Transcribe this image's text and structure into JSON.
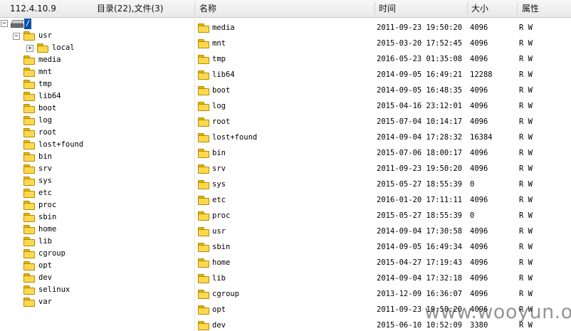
{
  "header": {
    "host": "112.4.10.9",
    "summary": "目录(22),文件(3)",
    "col_name": "名称",
    "col_time": "时间",
    "col_size": "大小",
    "col_attr": "属性"
  },
  "tree": {
    "root_label": "/",
    "items": [
      {
        "label": "usr",
        "expanded": true
      },
      {
        "label": "local",
        "expanded": false
      },
      {
        "label": "media"
      },
      {
        "label": "mnt"
      },
      {
        "label": "tmp"
      },
      {
        "label": "lib64"
      },
      {
        "label": "boot"
      },
      {
        "label": "log"
      },
      {
        "label": "root"
      },
      {
        "label": "lost+found"
      },
      {
        "label": "bin"
      },
      {
        "label": "srv"
      },
      {
        "label": "sys"
      },
      {
        "label": "etc"
      },
      {
        "label": "proc"
      },
      {
        "label": "sbin"
      },
      {
        "label": "home"
      },
      {
        "label": "lib"
      },
      {
        "label": "cgroup"
      },
      {
        "label": "opt"
      },
      {
        "label": "dev"
      },
      {
        "label": "selinux"
      },
      {
        "label": "var"
      }
    ]
  },
  "files": [
    {
      "name": "media",
      "time": "2011-09-23 19:50:20",
      "size": "4096",
      "attr": "R W"
    },
    {
      "name": "mnt",
      "time": "2015-03-20 17:52:45",
      "size": "4096",
      "attr": "R W"
    },
    {
      "name": "tmp",
      "time": "2016-05-23 01:35:08",
      "size": "4096",
      "attr": "R W"
    },
    {
      "name": "lib64",
      "time": "2014-09-05 16:49:21",
      "size": "12288",
      "attr": "R W"
    },
    {
      "name": "boot",
      "time": "2014-09-05 16:48:35",
      "size": "4096",
      "attr": "R W"
    },
    {
      "name": "log",
      "time": "2015-04-16 23:12:01",
      "size": "4096",
      "attr": "R W"
    },
    {
      "name": "root",
      "time": "2015-07-04 10:14:17",
      "size": "4096",
      "attr": "R W"
    },
    {
      "name": "lost+found",
      "time": "2014-09-04 17:28:32",
      "size": "16384",
      "attr": "R W"
    },
    {
      "name": "bin",
      "time": "2015-07-06 18:00:17",
      "size": "4096",
      "attr": "R W"
    },
    {
      "name": "srv",
      "time": "2011-09-23 19:50:20",
      "size": "4096",
      "attr": "R W"
    },
    {
      "name": "sys",
      "time": "2015-05-27 18:55:39",
      "size": "0",
      "attr": "R W"
    },
    {
      "name": "etc",
      "time": "2016-01-20 17:11:11",
      "size": "4096",
      "attr": "R W"
    },
    {
      "name": "proc",
      "time": "2015-05-27 18:55:39",
      "size": "0",
      "attr": "R W"
    },
    {
      "name": "usr",
      "time": "2014-09-04 17:30:58",
      "size": "4096",
      "attr": "R W"
    },
    {
      "name": "sbin",
      "time": "2014-09-05 16:49:34",
      "size": "4096",
      "attr": "R W"
    },
    {
      "name": "home",
      "time": "2015-04-27 17:19:43",
      "size": "4096",
      "attr": "R W"
    },
    {
      "name": "lib",
      "time": "2014-09-04 17:32:18",
      "size": "4096",
      "attr": "R W"
    },
    {
      "name": "cgroup",
      "time": "2013-12-09 16:36:07",
      "size": "4096",
      "attr": "R W"
    },
    {
      "name": "opt",
      "time": "2011-09-23 19:50:20",
      "size": "4096",
      "attr": "R W"
    },
    {
      "name": "dev",
      "time": "2015-06-10 10:52:09",
      "size": "3380",
      "attr": "R W"
    }
  ],
  "watermark": "www.wooyun.org",
  "icons": {
    "folder": "folder-icon",
    "drive": "drive-icon",
    "collapse": "collapse-icon",
    "expand": "expand-icon"
  },
  "colors": {
    "selection": "#0a4fa8",
    "folder": "#ffd84d",
    "header_bg": "#ececec"
  }
}
